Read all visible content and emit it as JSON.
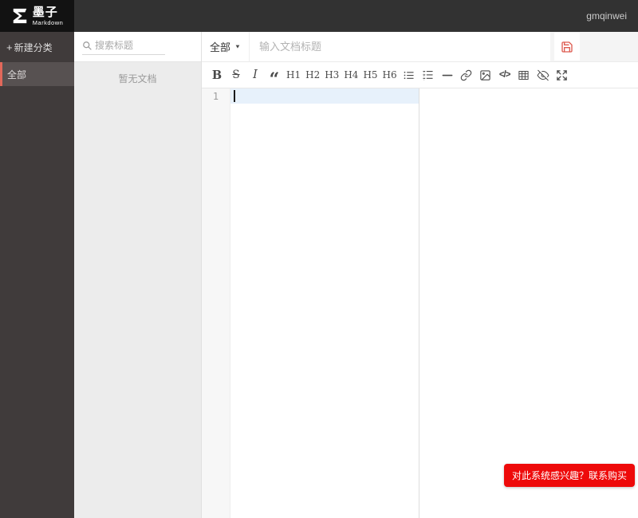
{
  "header": {
    "logo_title": "墨子",
    "logo_subtitle": "Markdown",
    "username": "gmqinwei"
  },
  "sidebar": {
    "new_category_label": "新建分类",
    "items": [
      {
        "label": "全部",
        "selected": true
      }
    ]
  },
  "doclist": {
    "search_placeholder": "搜索标题",
    "empty_text": "暂无文档"
  },
  "titlebar": {
    "category": "全部",
    "title_placeholder": "输入文档标题",
    "title_value": ""
  },
  "toolbar": {
    "bold": "B",
    "strikethrough": "S",
    "italic": "I",
    "quote": "“",
    "h1": "H1",
    "h2": "H2",
    "h3": "H3",
    "h4": "H4",
    "h5": "H5",
    "h6": "H6",
    "code_label": "</>"
  },
  "editor": {
    "line_number": "1"
  },
  "floating": {
    "buy_label": "对此系统感兴趣？联系购买"
  },
  "icons": {
    "plus": "+",
    "chevron_down": "▼"
  },
  "colors": {
    "header_bg": "#323232",
    "logo_bg": "#121212",
    "sidebar_bg": "#403b3b",
    "sidebar_selected_bg": "#575151",
    "sidebar_accent": "#e2685a",
    "doclist_bg": "#ececec",
    "active_line_bg": "#e7f1fb",
    "save_icon": "#dd5a4f",
    "buy_button_bg": "#ee0a0a"
  }
}
